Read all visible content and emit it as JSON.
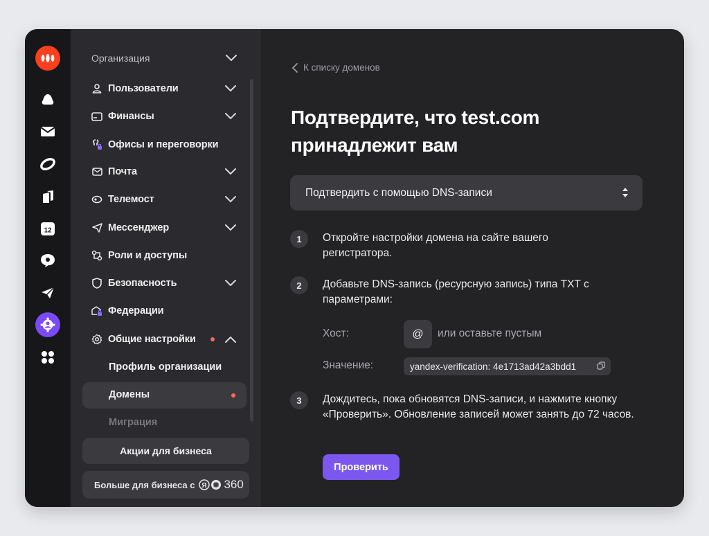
{
  "colors": {
    "accent": "#7b57f0",
    "brand": "#fc3f1d",
    "notification_dot": "#fb6a5b",
    "rail_active": "#7b49f5"
  },
  "rail": {
    "icons": [
      "yandex-360-logo-icon",
      "cloud-disk-icon",
      "mail-icon",
      "telemost-icon",
      "documents-icon",
      "calendar-icon",
      "messenger-icon",
      "send-icon",
      "admin-icon",
      "apps-icon"
    ],
    "calendar_day": "12"
  },
  "sidebar": {
    "org_header": "Организация",
    "items": [
      {
        "label": "Пользователи",
        "icon": "user-icon",
        "chevron": "down"
      },
      {
        "label": "Финансы",
        "icon": "card-icon",
        "chevron": "down"
      },
      {
        "label": "Офисы и переговорки",
        "icon": "office-lock-icon",
        "chevron": ""
      },
      {
        "label": "Почта",
        "icon": "mail-icon",
        "chevron": "down"
      },
      {
        "label": "Телемост",
        "icon": "telemost-icon",
        "chevron": "down"
      },
      {
        "label": "Мессенджер",
        "icon": "send-icon",
        "chevron": "down"
      },
      {
        "label": "Роли и доступы",
        "icon": "roles-icon",
        "chevron": ""
      },
      {
        "label": "Безопасность",
        "icon": "shield-icon",
        "chevron": "down"
      },
      {
        "label": "Федерации",
        "icon": "federation-lock-icon",
        "chevron": ""
      },
      {
        "label": "Общие настройки",
        "icon": "gear-icon",
        "chevron": "up"
      }
    ],
    "sub_items": {
      "profile": "Профиль организации",
      "domains": "Домены",
      "migration": "Миграция"
    },
    "promo_button": "Акции для бизнеса",
    "more_button": "Больше для бизнеса с",
    "more_brand_number": "360"
  },
  "main": {
    "back_link": "К списку доменов",
    "title_line1": "Подтвердите, что test.com",
    "title_line2": "принадлежит вам",
    "method_select": "Подтвердить с помощью DNS-записи",
    "steps": [
      {
        "num": "1",
        "text": "Откройте настройки домена на сайте вашего регистратора."
      },
      {
        "num": "2",
        "text": "Добавьте DNS-запись (ресурсную запись) типа TXT с параметрами:"
      },
      {
        "num": "3",
        "text": "Дождитесь, пока обновятся DNS-записи, и нажмите кнопку «Проверить». Обновление записей может занять до 72 часов."
      }
    ],
    "host_label": "Хост:",
    "host_value": "@",
    "host_hint": "или оставьте пустым",
    "value_label": "Значение:",
    "value": "yandex-verification: 4e1713ad42a3bdd1",
    "check_button": "Проверить"
  }
}
